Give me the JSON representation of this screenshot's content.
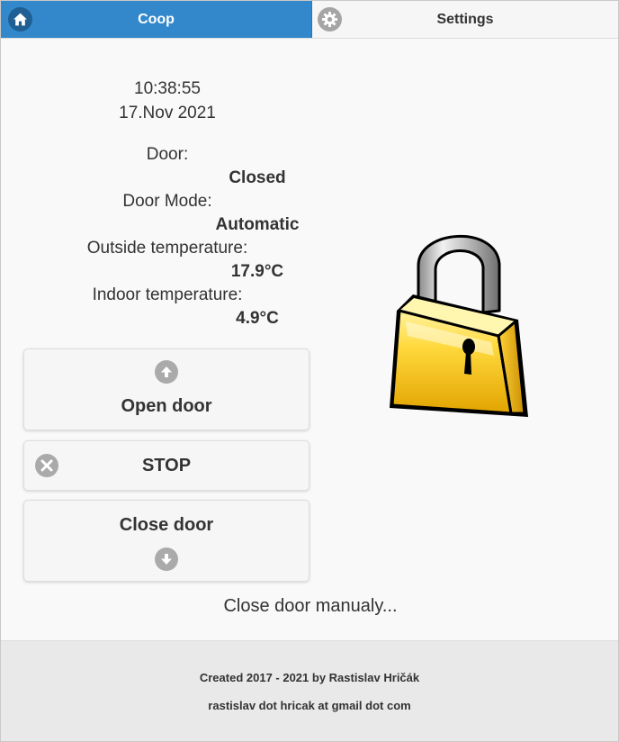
{
  "nav": {
    "tabs": [
      {
        "label": "Coop",
        "icon": "home-icon",
        "active": true
      },
      {
        "label": "Settings",
        "icon": "gear-icon",
        "active": false
      }
    ],
    "active_color": "#3388cc"
  },
  "status": {
    "time": "10:38:55",
    "date": "17.Nov 2021",
    "door_label": "Door:",
    "door_value": "Closed",
    "mode_label": "Door Mode:",
    "mode_value": "Automatic",
    "outside_label": "Outside temperature:",
    "outside_value": "17.9°C",
    "indoor_label": "Indoor temperature:",
    "indoor_value": "4.9°C"
  },
  "buttons": {
    "open": {
      "label": "Open door",
      "icon": "arrow-up-icon"
    },
    "stop": {
      "label": "STOP",
      "icon": "close-icon"
    },
    "close": {
      "label": "Close door",
      "icon": "arrow-down-icon"
    }
  },
  "manual_link": "Close door manualy...",
  "lock_icon": "padlock-closed-icon",
  "footer": {
    "created": "Created 2017 - 2021 by Rastislav Hričák",
    "email": "rastislav dot hricak at gmail dot com"
  }
}
